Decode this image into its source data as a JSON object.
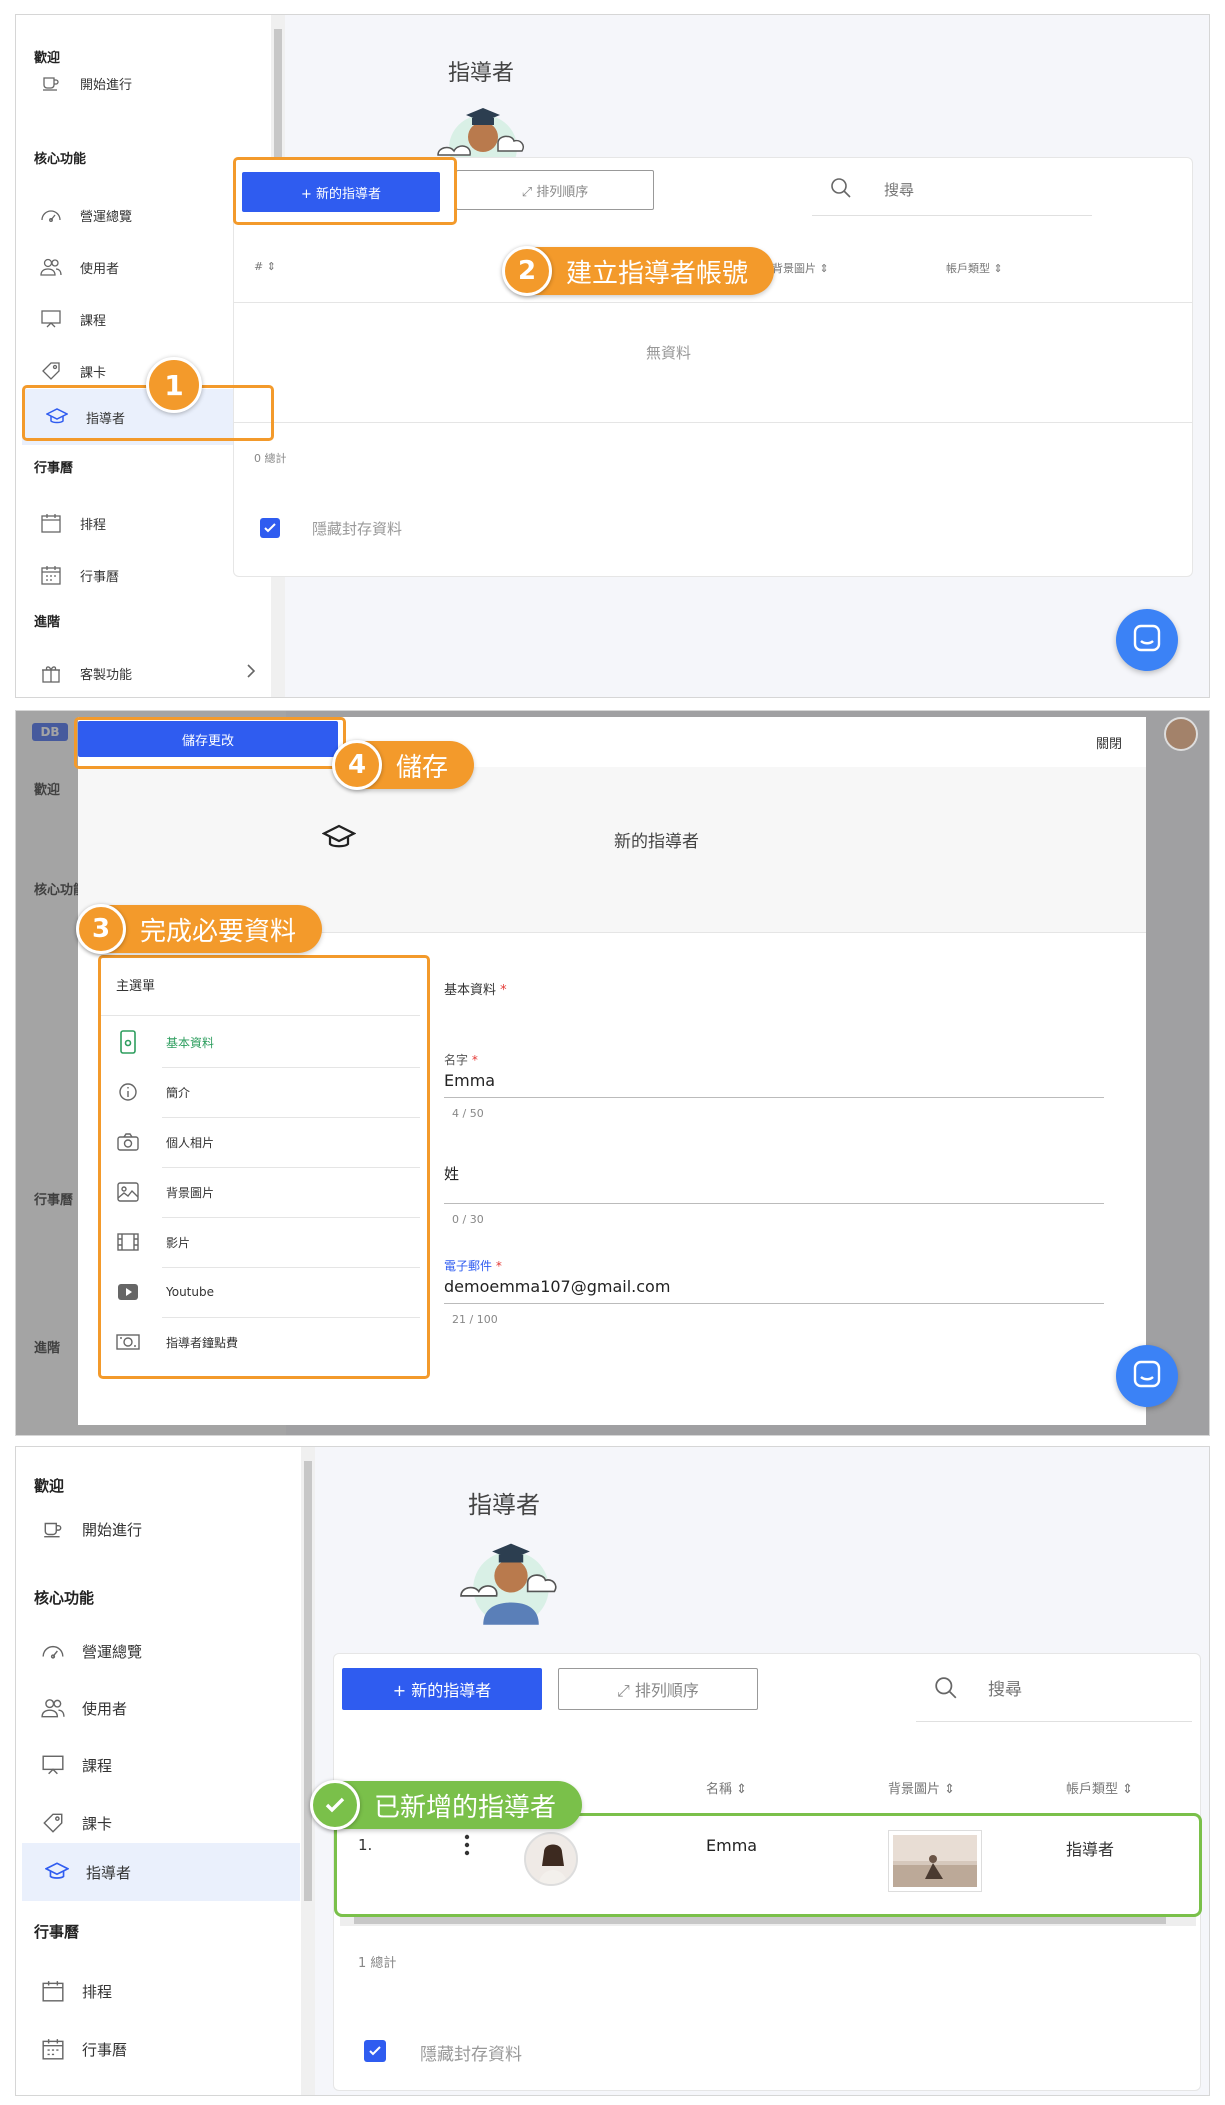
{
  "colors": {
    "primary": "#2f5cf0",
    "highlight_orange": "#f39a2b",
    "highlight_green": "#7ac04a",
    "menu_active_green": "#2e9e5f",
    "chat": "#3b82f6"
  },
  "sidebar": {
    "sections": {
      "welcome": "歡迎",
      "core": "核心功能",
      "calendar": "行事曆",
      "advanced": "進階"
    },
    "items": {
      "start": "開始進行",
      "overview": "營運總覽",
      "users": "使用者",
      "courses": "課程",
      "cards": "課卡",
      "mentors": "指導者",
      "schedule": "排程",
      "calendar": "行事曆",
      "custom": "客製功能"
    }
  },
  "page": {
    "title": "指導者",
    "new_button": "+  新的指導者",
    "sort_button": "⤢  排列順序",
    "search_placeholder": "搜尋",
    "columns": {
      "index": "#",
      "name": "名稱",
      "background": "背景圖片",
      "account_type": "帳戶類型"
    },
    "no_data": "無資料",
    "total_empty": "0 總計",
    "total_one": "1 總計",
    "hide_archived": "隱藏封存資料"
  },
  "row": {
    "index": "1.",
    "name": "Emma",
    "account_type": "指導者"
  },
  "modal": {
    "logo": "DB",
    "save": "儲存更改",
    "close": "關閉",
    "title": "新的指導者",
    "menu_title": "主選單",
    "menu": {
      "basic": "基本資料",
      "intro": "簡介",
      "photo": "個人相片",
      "background": "背景圖片",
      "video": "影片",
      "youtube": "Youtube",
      "fee": "指導者鐘點費"
    },
    "section_title": "基本資料",
    "first_name_label": "名字",
    "first_name_value": "Emma",
    "first_name_count": "4 / 50",
    "last_name_label": "姓",
    "last_name_count": "0 / 30",
    "email_label": "電子郵件",
    "email_value": "demoemma107@gmail.com",
    "email_count": "21 / 100",
    "required_mark": "*"
  },
  "callouts": {
    "step1": "1",
    "step2_num": "2",
    "step2": "建立指導者帳號",
    "step3_num": "3",
    "step3": "完成必要資料",
    "step4_num": "4",
    "step4": "儲存",
    "added": "已新增的指導者"
  }
}
